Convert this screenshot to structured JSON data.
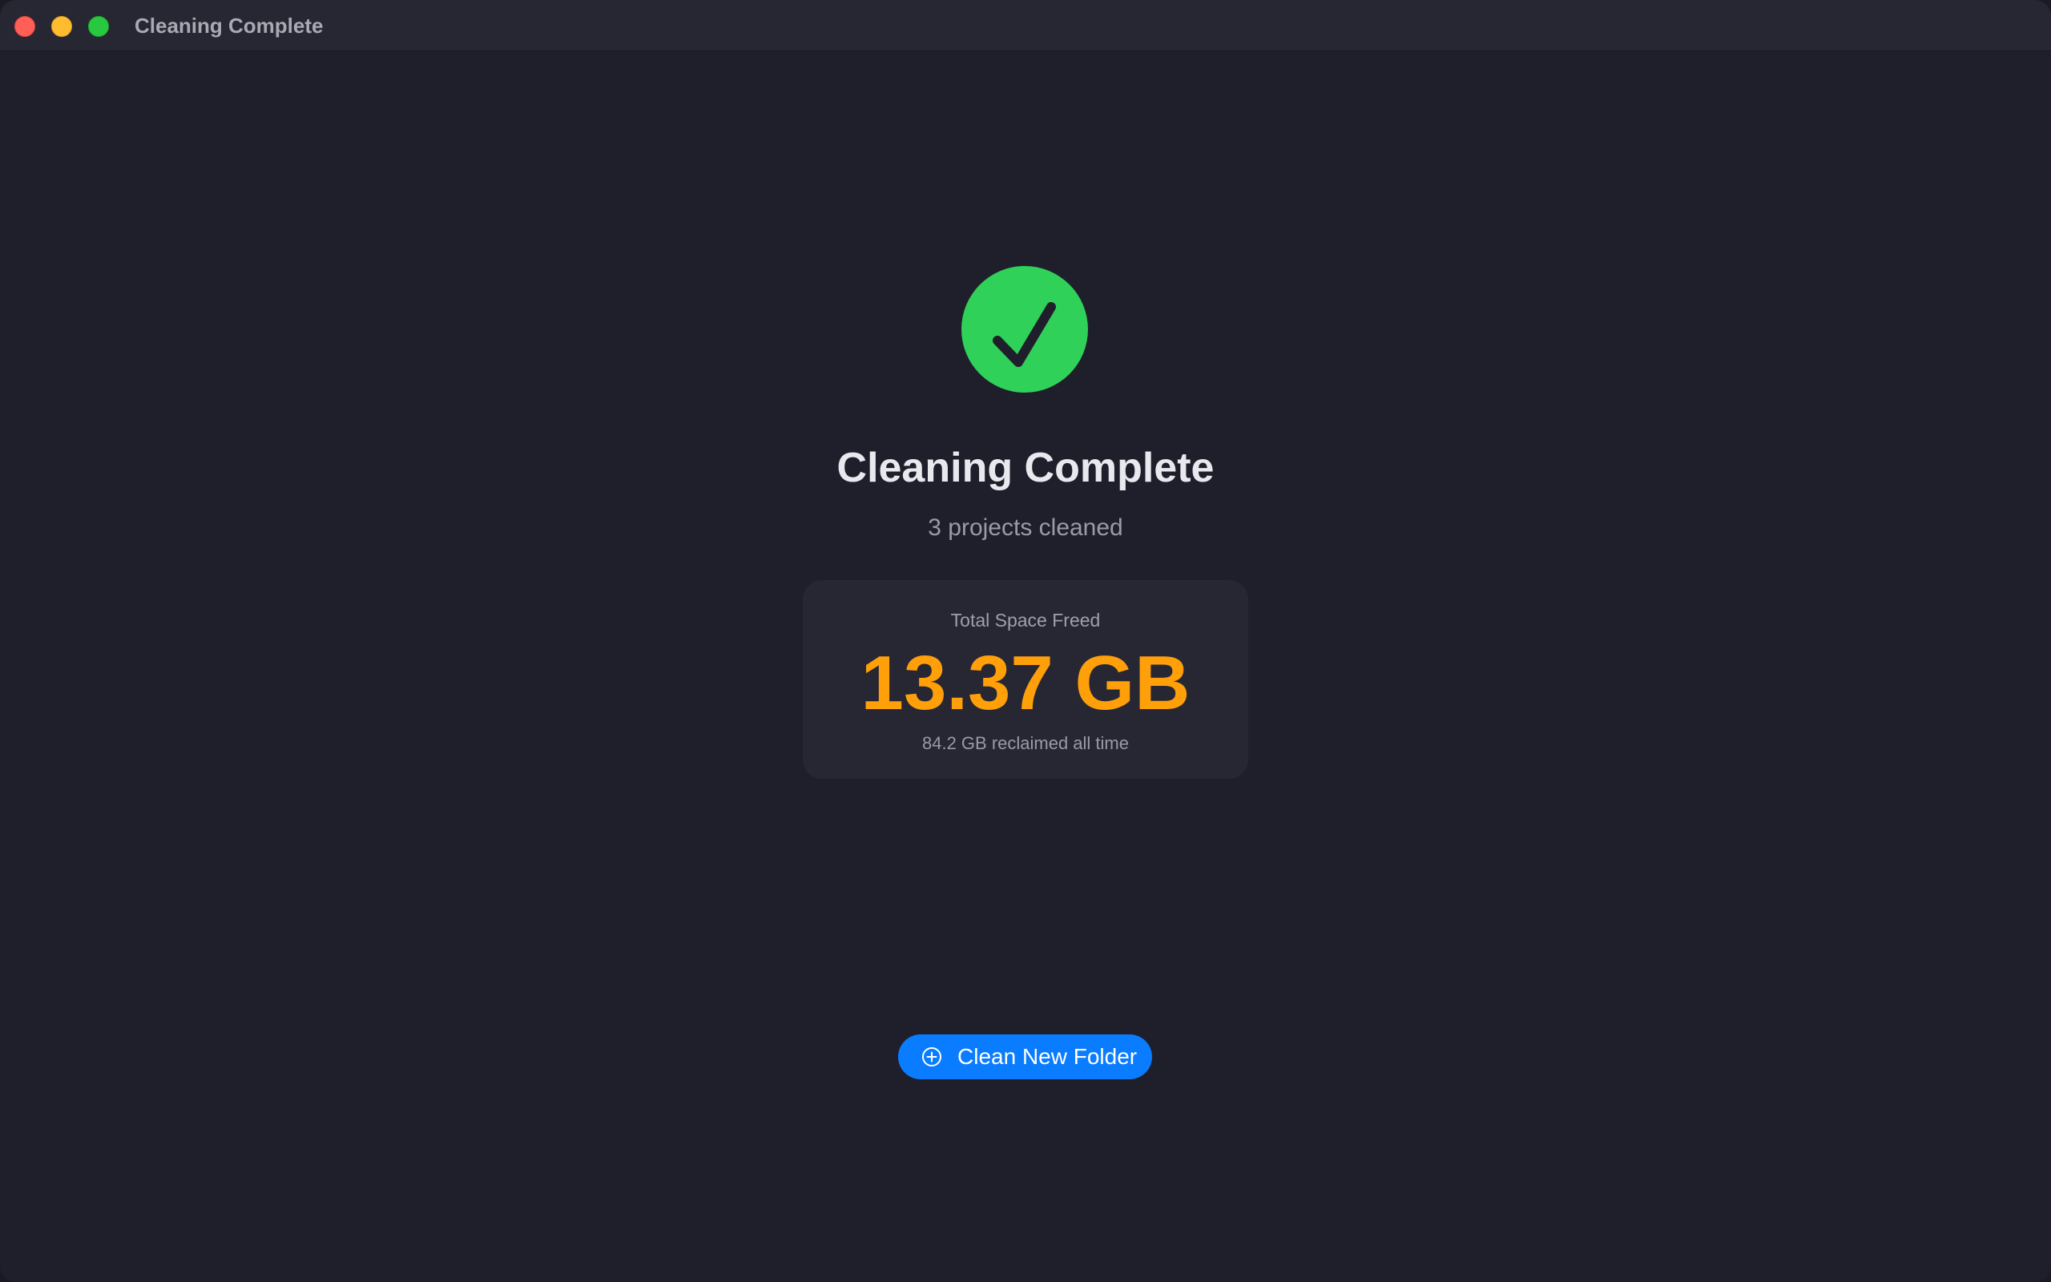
{
  "window": {
    "title": "Cleaning Complete"
  },
  "main": {
    "status_icon": "checkmark-circle-icon",
    "title": "Cleaning Complete",
    "subtitle": "3 projects cleaned",
    "stats": {
      "label": "Total Space Freed",
      "value": "13.37 GB",
      "footnote": "84.2 GB reclaimed all time"
    },
    "action_button": {
      "icon": "plus-circle-icon",
      "label": "Clean New Folder"
    }
  },
  "colors": {
    "success": "#30d158",
    "accent_value": "#ff9f0a",
    "button": "#0a7cff",
    "background": "#1f1f2c",
    "card": "#272733"
  }
}
